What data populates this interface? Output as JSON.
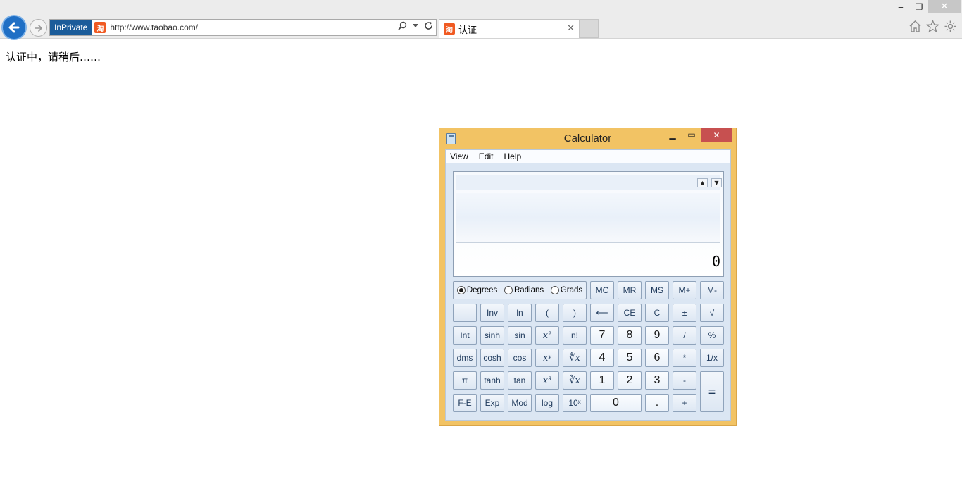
{
  "browser": {
    "inprivate_label": "InPrivate",
    "url": "http://www.taobao.com/",
    "favicon_text": "淘",
    "tab_title": "认证",
    "window_buttons": {
      "minimize": "‒",
      "restore": "❐",
      "close": "✕"
    },
    "icons": [
      "back-arrow-icon",
      "forward-arrow-icon",
      "search-icon",
      "dropdown-icon",
      "refresh-icon",
      "home-icon",
      "favorites-star-icon",
      "settings-gear-icon"
    ]
  },
  "page": {
    "message": "认证中，请稍后……"
  },
  "calculator": {
    "title": "Calculator",
    "menu": [
      "View",
      "Edit",
      "Help"
    ],
    "display_value": "0",
    "angle_modes": [
      {
        "label": "Degrees",
        "selected": true
      },
      {
        "label": "Radians",
        "selected": false
      },
      {
        "label": "Grads",
        "selected": false
      }
    ],
    "keys": {
      "mc": "MC",
      "mr": "MR",
      "ms": "MS",
      "mplus": "M+",
      "mminus": "M-",
      "inv": "Inv",
      "ln": "ln",
      "lparen": "(",
      "rparen": ")",
      "backspace": "⟵",
      "ce": "CE",
      "c": "C",
      "plusminus": "±",
      "sqrt": "√",
      "int": "Int",
      "sinh": "sinh",
      "sin": "sin",
      "xsq": "x²",
      "fact": "n!",
      "n7": "7",
      "n8": "8",
      "n9": "9",
      "div": "/",
      "pct": "%",
      "dms": "dms",
      "cosh": "cosh",
      "cos": "cos",
      "xpowy": "xʸ",
      "yroot": "∜x",
      "n4": "4",
      "n5": "5",
      "n6": "6",
      "mul": "*",
      "recip": "1/x",
      "pi": "π",
      "tanh": "tanh",
      "tan": "tan",
      "xcube": "x³",
      "cuberoot": "∛x",
      "n1": "1",
      "n2": "2",
      "n3": "3",
      "sub": "-",
      "eq": "=",
      "fe": "F-E",
      "exp": "Exp",
      "mod": "Mod",
      "log": "log",
      "tenx": "10ˣ",
      "n0": "0",
      "dot": ".",
      "add": "+"
    }
  }
}
